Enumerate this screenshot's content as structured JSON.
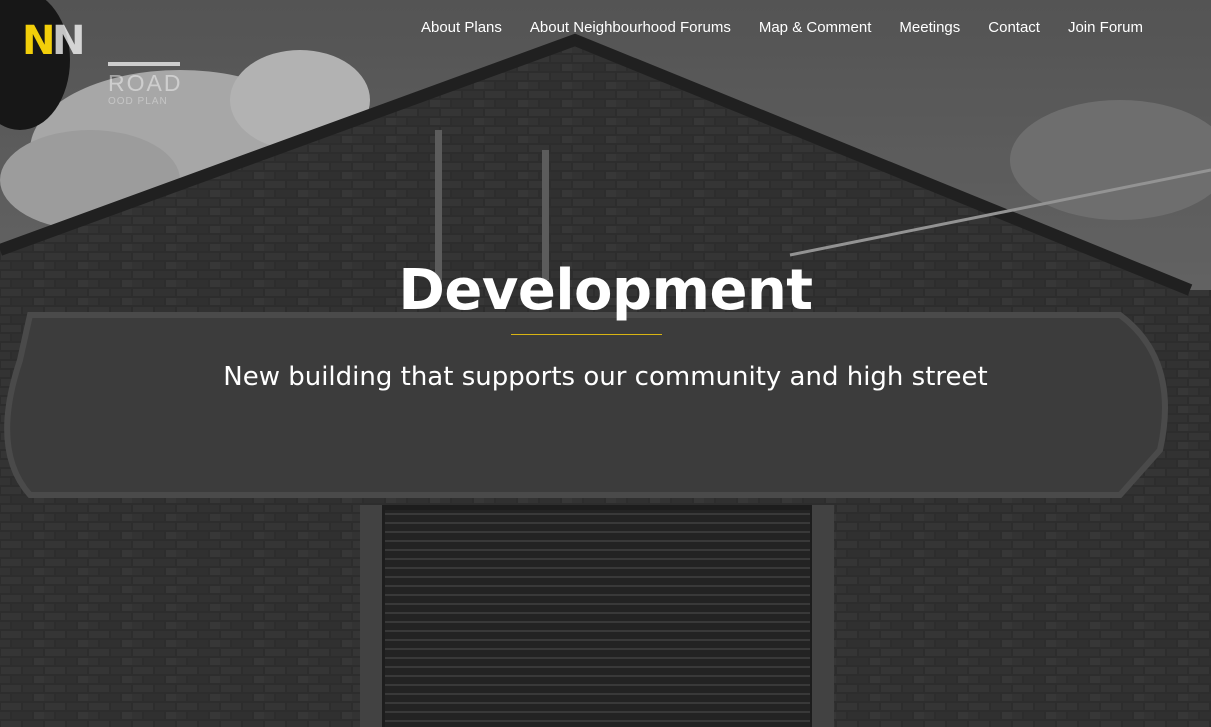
{
  "logo": {
    "letter": "N",
    "word": "      N",
    "line2": "ROAD",
    "line3": "OOD PLAN"
  },
  "nav": {
    "items": [
      {
        "label": "About Plans"
      },
      {
        "label": "About Neighbourhood Forums"
      },
      {
        "label": "Map & Comment"
      },
      {
        "label": "Meetings"
      },
      {
        "label": "Contact"
      },
      {
        "label": "Join Forum"
      }
    ]
  },
  "hero": {
    "title": "Development",
    "subtitle": "New building that supports our community and high street",
    "accent_color": "#d8b413"
  }
}
